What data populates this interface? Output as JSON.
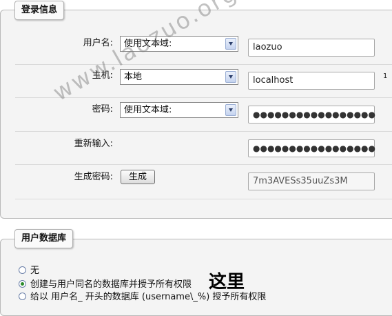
{
  "login_section": {
    "legend": "登录信息",
    "username": {
      "label": "用户名:",
      "select": "使用文本域:",
      "value": "laozuo"
    },
    "host": {
      "label": "主机:",
      "select": "本地",
      "value": "localhost",
      "note": "1"
    },
    "password": {
      "label": "密码:",
      "select": "使用文本域:",
      "value": "●●●●●●●●●●●●●●●●●"
    },
    "retype": {
      "label": "重新输入:",
      "value": "●●●●●●●●●●●●●●●●●"
    },
    "generate": {
      "label": "生成密码:",
      "button": "生成",
      "value": "7m3AVESs35uuZs3M"
    }
  },
  "db_section": {
    "legend": "用户数据库",
    "options": [
      {
        "label": "无",
        "checked": false
      },
      {
        "label": "创建与用户同名的数据库并授予所有权限",
        "checked": true
      },
      {
        "label": "给以 用户名_ 开头的数据库 (username\\_%) 授予所有权限",
        "checked": false
      }
    ],
    "annotation": "这里"
  },
  "watermark": "www.laozuo.org"
}
